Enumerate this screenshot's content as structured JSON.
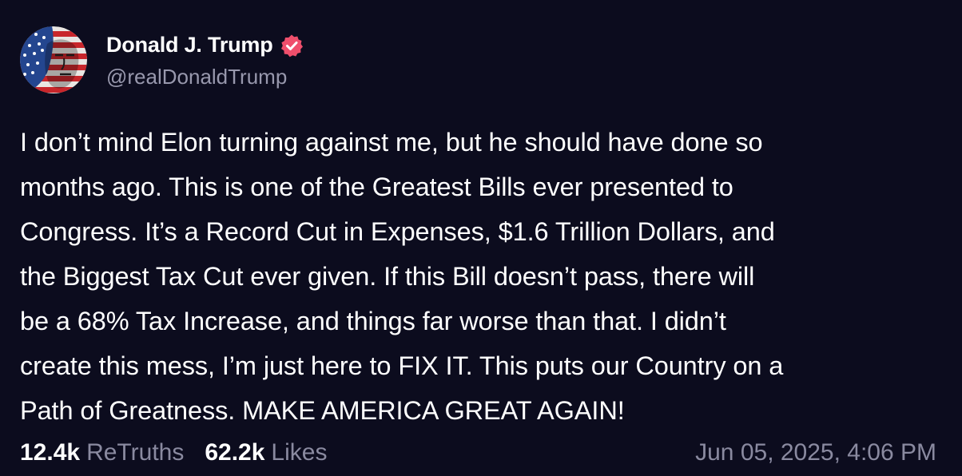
{
  "author": {
    "display_name": "Donald J. Trump",
    "handle": "@realDonaldTrump",
    "verified": true,
    "avatar": "avatar-image"
  },
  "post": {
    "text": "I don’t mind Elon turning against me, but he should have done so\nmonths ago. This is one of the Greatest Bills ever presented to\nCongress. It’s a Record Cut in Expenses, $1.6 Trillion Dollars, and\nthe Biggest Tax Cut ever given. If this Bill doesn’t pass, there will\nbe a 68% Tax Increase, and things far worse than that. I didn’t\ncreate this mess, I’m just here to FIX IT. This puts our Country on a\nPath of Greatness. MAKE AMERICA GREAT AGAIN!"
  },
  "stats": {
    "retruths_count": "12.4k",
    "retruths_label": "ReTruths",
    "likes_count": "62.2k",
    "likes_label": "Likes"
  },
  "timestamp": "Jun 05, 2025, 4:06 PM",
  "colors": {
    "background": "#0c0c1e",
    "text_primary": "#ffffff",
    "text_secondary": "#8a8aa0",
    "verified_badge": "#ef4f6c"
  },
  "icons": {
    "verified": "verified-badge-icon"
  }
}
